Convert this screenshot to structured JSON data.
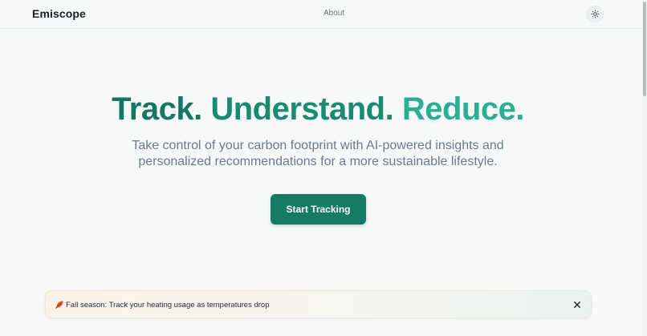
{
  "header": {
    "brand": "Emiscope",
    "nav_about": "About",
    "theme_toggle_icon": "sun-icon"
  },
  "hero": {
    "title_part_1": "Track.",
    "title_part_2": "Understand.",
    "title_part_3": "Reduce.",
    "subtitle": "Take control of your carbon footprint with AI-powered insights and personalized recommendations for a more sustainable lifestyle.",
    "cta_label": "Start Tracking"
  },
  "notification": {
    "icon": "fallen-leaf-icon",
    "text": "Fall season: Track your heating usage as temperatures drop",
    "close_icon": "close-icon"
  },
  "colors": {
    "brand_dark": "#147764",
    "brand_mid": "#1a8a73",
    "brand_light": "#2bae91",
    "cta_background": "#167a66"
  }
}
